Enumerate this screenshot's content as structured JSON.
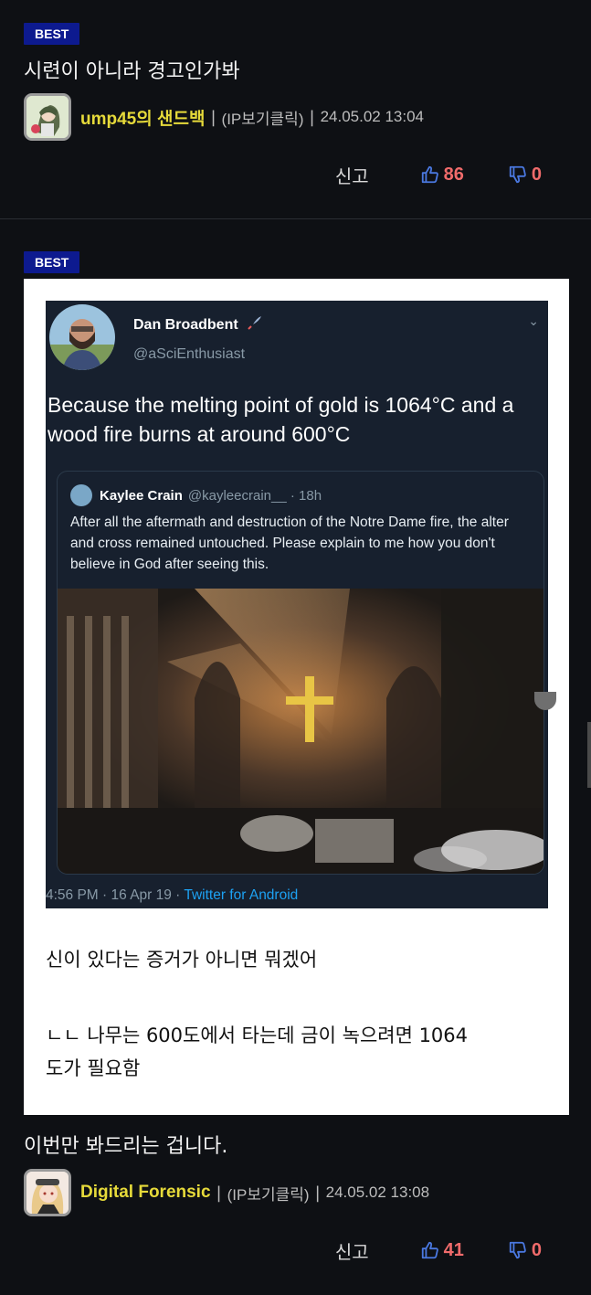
{
  "posts": [
    {
      "badge": "BEST",
      "title": "시련이 아니라 경고인가봐",
      "author": "ump45의 샌드백",
      "sep1": "|",
      "ip": "(IP보기클릭)",
      "sep2": "|",
      "timestamp": "24.05.02 13:04",
      "report_label": "신고",
      "upvotes": "86",
      "downvotes": "0"
    },
    {
      "badge": "BEST",
      "tweet": {
        "name": "Dan Broadbent",
        "handle": "@aSciEnthusiast",
        "text": "Because the melting point of gold is 1064°C and a wood fire burns at around 600°C",
        "quote": {
          "name": "Kaylee Crain",
          "handle": "@kayleecrain__ · 18h",
          "text": "After all the aftermath and destruction of the Notre Dame fire, the alter and cross remained untouched. Please explain to me how you don't believe in God after seeing this."
        },
        "footer_time": "4:56 PM · 16 Apr 19 · ",
        "footer_app": "Twitter for Android"
      },
      "caption_1": "신이 있다는 증거가 아니면 뭐겠어",
      "caption_2a": "ㄴㄴ 나무는 600도에서 타는데 금이 녹으려면 1064",
      "caption_2b": "도가 필요함",
      "title": "이번만 봐드리는 겁니다.",
      "author": "Digital Forensic",
      "sep1": "|",
      "ip": "(IP보기클릭)",
      "sep2": "|",
      "timestamp": "24.05.02 13:08",
      "report_label": "신고",
      "upvotes": "41",
      "downvotes": "0"
    }
  ],
  "colors": {
    "background": "#0e1014",
    "badge": "#0d1a8f",
    "nickname": "#e6da3a",
    "vote_icon": "#4a78e0",
    "vote_count": "#f06b6b"
  },
  "icons": [
    "thumbs-up-icon",
    "thumbs-down-icon",
    "rocket-icon",
    "chevron-down-icon"
  ]
}
